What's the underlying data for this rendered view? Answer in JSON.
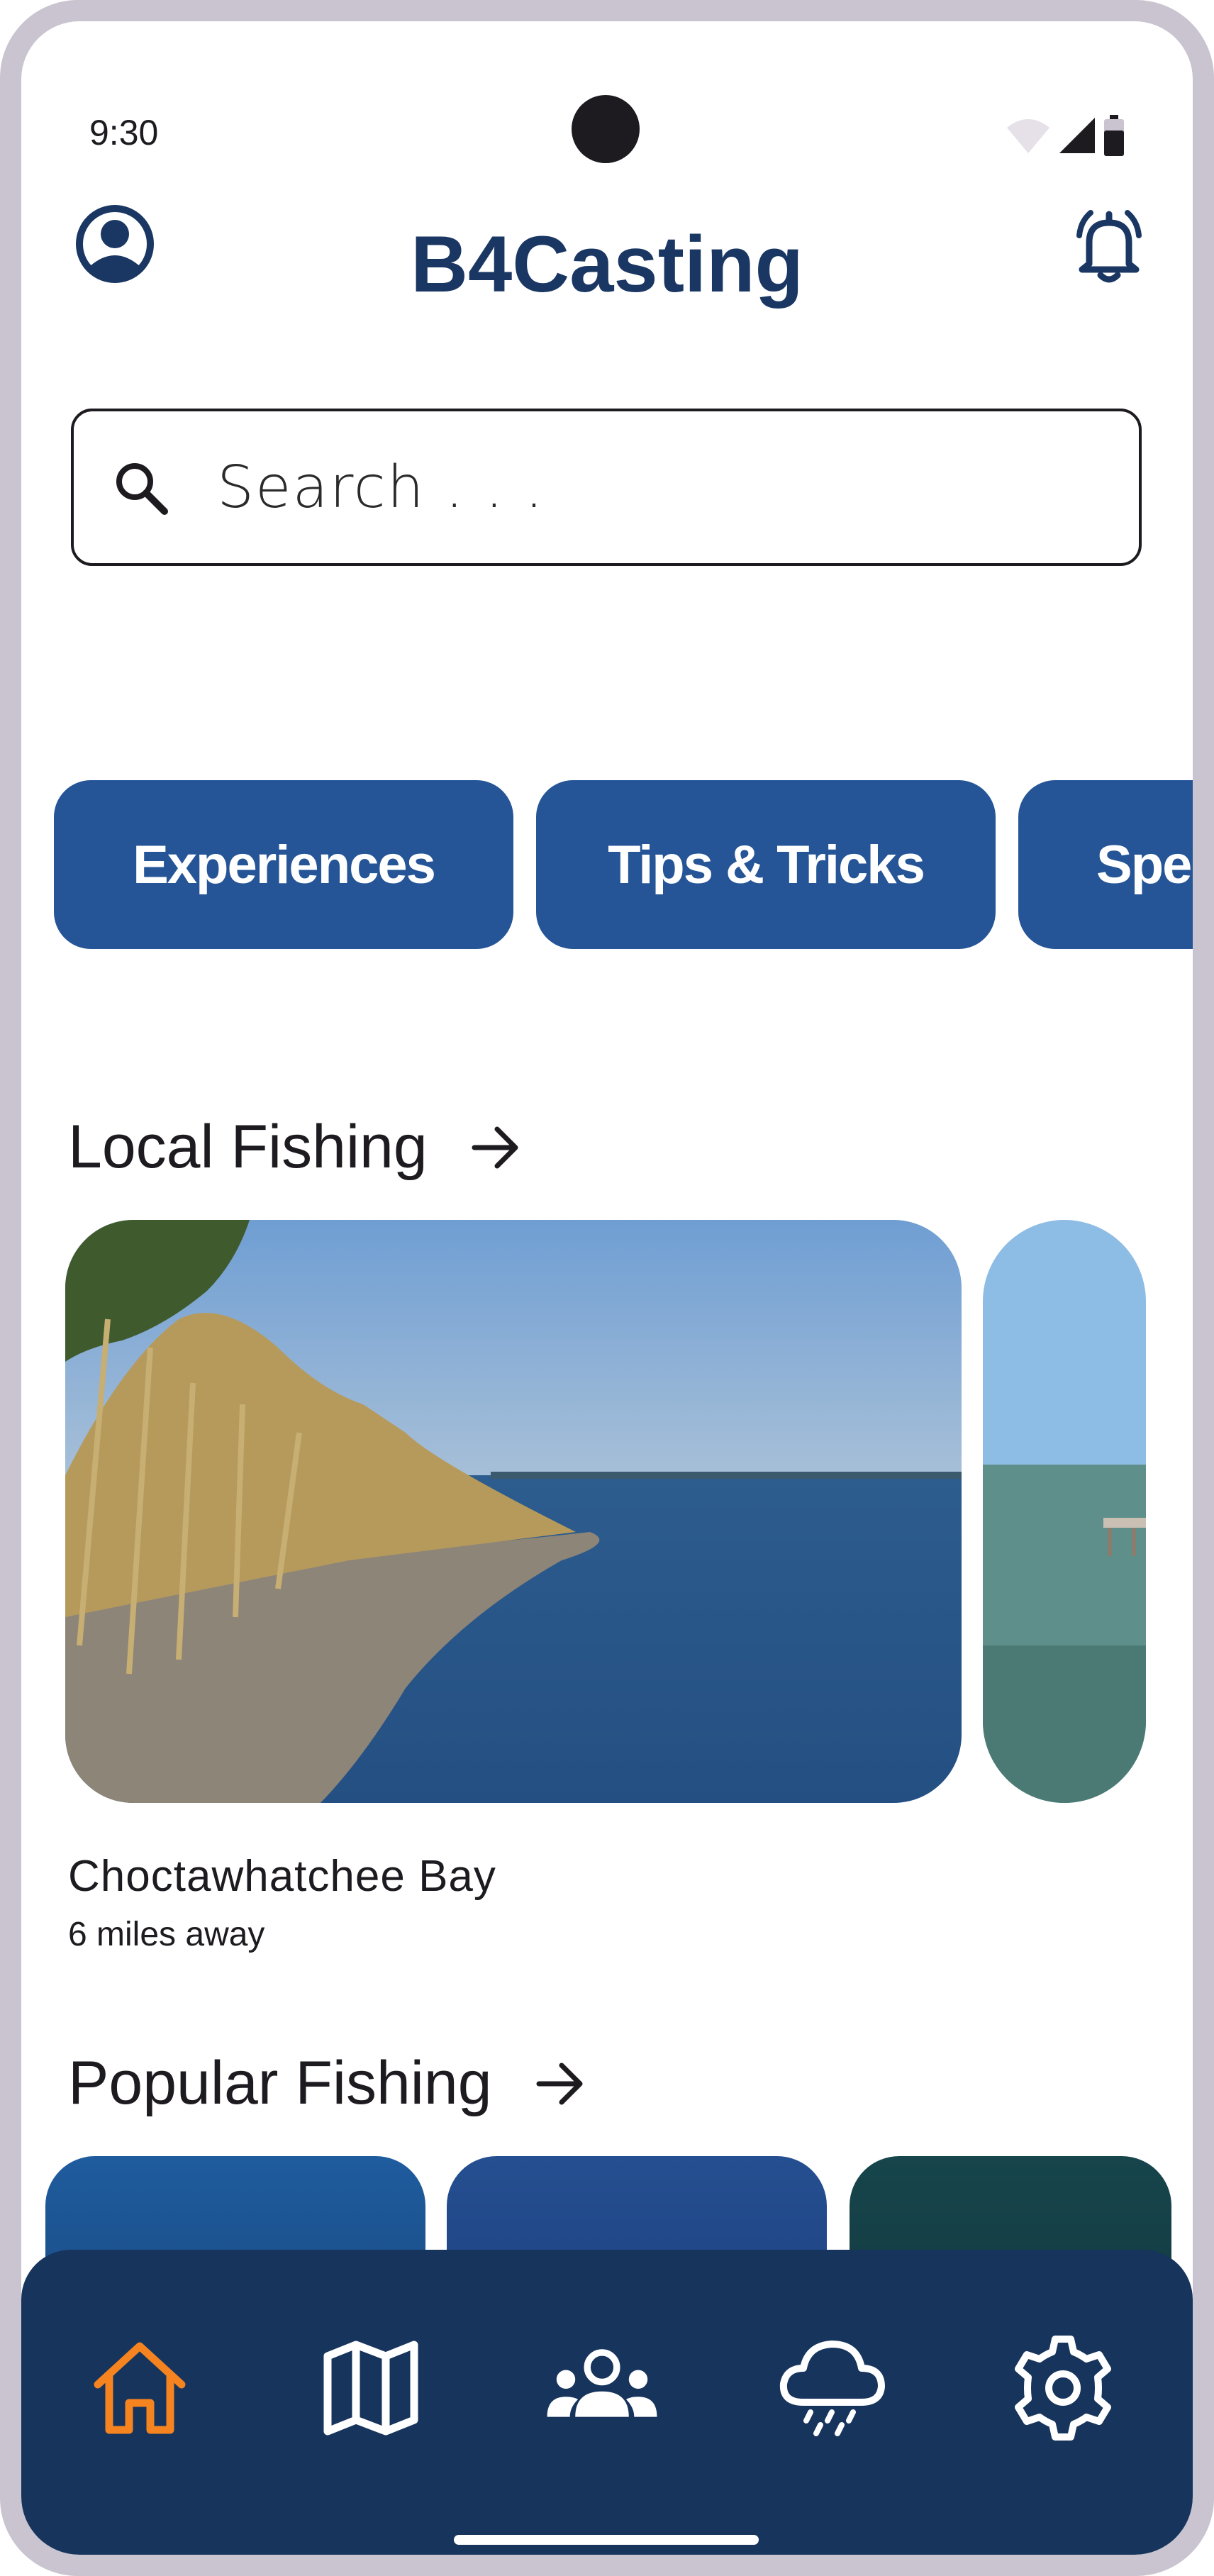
{
  "status_bar": {
    "time": "9:30",
    "icons": [
      "wifi-icon",
      "signal-icon",
      "battery-icon"
    ]
  },
  "header": {
    "title": "B4Casting",
    "left_icon": "account-circle-icon",
    "right_icon": "notification-bell-icon"
  },
  "search": {
    "placeholder": "Search . . .",
    "value": "",
    "icon": "search-icon"
  },
  "chips": [
    {
      "label": "Experiences"
    },
    {
      "label": "Tips & Tricks"
    },
    {
      "label": "Spe"
    }
  ],
  "local_fishing": {
    "title": "Local Fishing",
    "arrow_icon": "arrow-right-icon",
    "cards": [
      {
        "name": "Choctawhatchee Bay",
        "distance": "6 miles away",
        "image": "bay-shoreline-photo"
      },
      {
        "image": "bay-pier-photo"
      }
    ]
  },
  "popular_fishing": {
    "title": "Popular Fishing",
    "arrow_icon": "arrow-right-icon",
    "cards": [
      {
        "image": "underwater-fish-photo"
      },
      {
        "image": "ocean-surface-photo"
      },
      {
        "image": "deep-water-photo"
      }
    ]
  },
  "bottom_nav": {
    "items": [
      {
        "icon": "home-icon",
        "active": true
      },
      {
        "icon": "map-icon",
        "active": false
      },
      {
        "icon": "community-icon",
        "active": false
      },
      {
        "icon": "weather-icon",
        "active": false
      },
      {
        "icon": "settings-icon",
        "active": false
      }
    ]
  },
  "colors": {
    "brand_navy": "#16345c",
    "title_blue": "#1a3763",
    "chip_blue": "#255597",
    "active_orange": "#f5831f",
    "frame": "#cac4d0"
  }
}
